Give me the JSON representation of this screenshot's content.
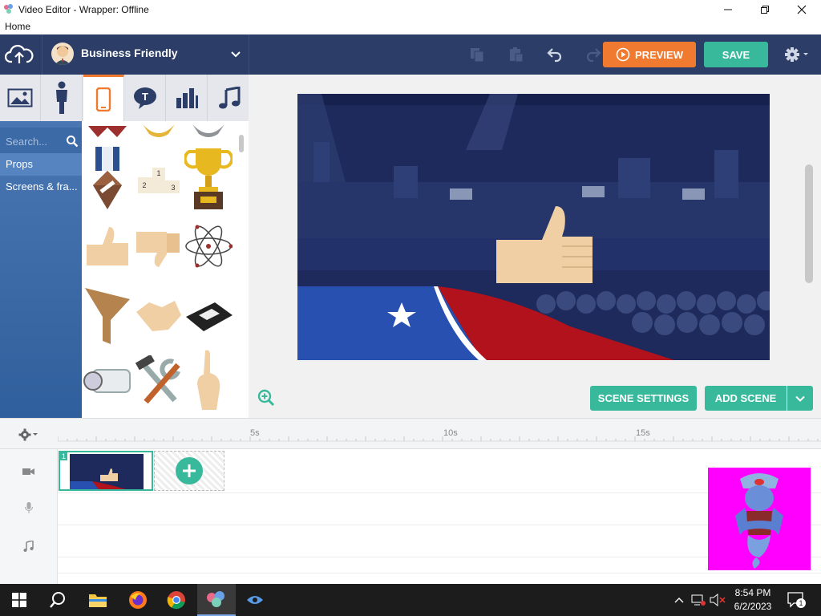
{
  "window": {
    "title": "Video Editor - Wrapper: Offline",
    "menu_home": "Home"
  },
  "toolbar": {
    "theme_name": "Business Friendly",
    "preview_label": "PREVIEW",
    "save_label": "SAVE"
  },
  "assets": {
    "search_placeholder": "Search...",
    "categories": [
      "Props",
      "Screens & fra..."
    ],
    "active_category": "Props",
    "podium_labels": [
      "1",
      "2",
      "3"
    ]
  },
  "stage": {
    "scene_settings_label": "SCENE SETTINGS",
    "add_scene_label": "ADD SCENE"
  },
  "timeline": {
    "ticks": [
      "5s",
      "10s",
      "15s"
    ],
    "scene_number": "1"
  },
  "taskbar": {
    "time": "8:54 PM",
    "date": "6/2/2023",
    "notification_count": "1"
  },
  "colors": {
    "toolbar_bg": "#2c3e67",
    "accent_orange": "#f07a2f",
    "accent_teal": "#38b99c",
    "category_bg": "#3c6aa6",
    "genie_bg": "#ff00ff"
  }
}
